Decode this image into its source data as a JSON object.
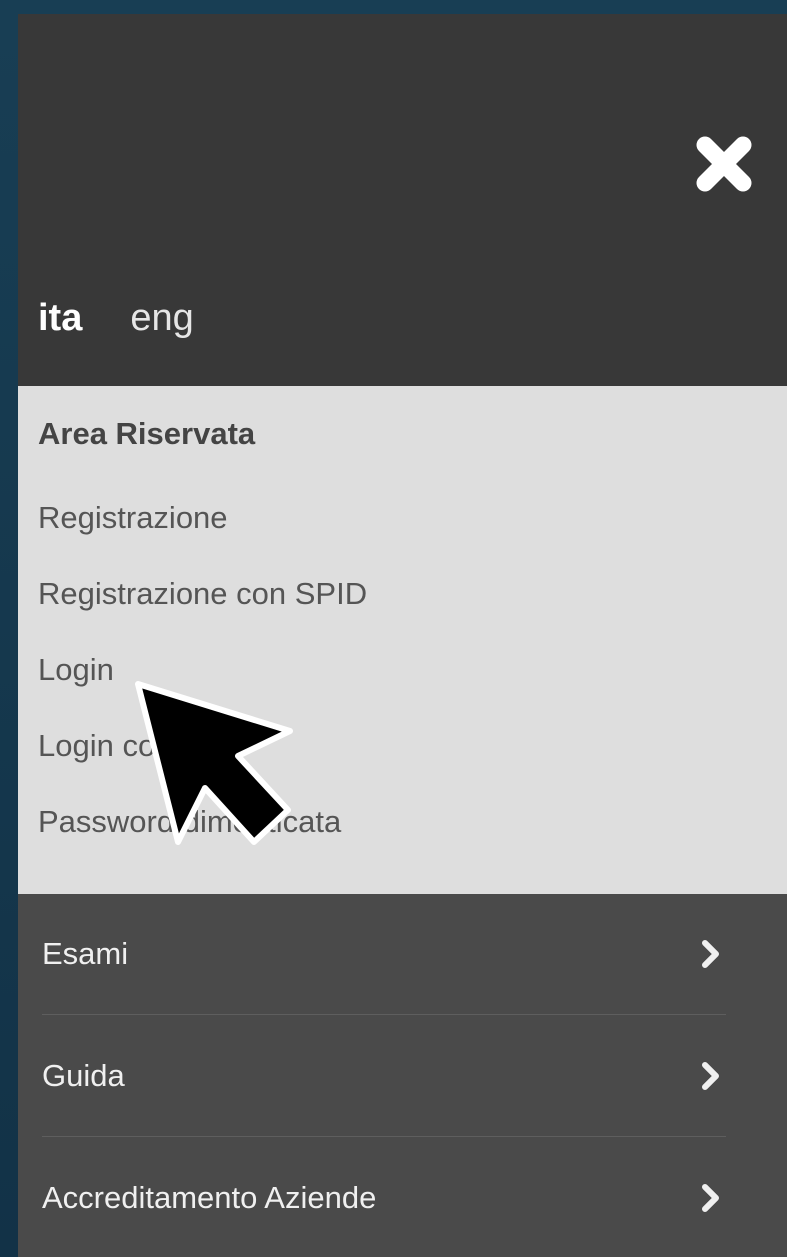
{
  "header": {
    "close_icon": "close-icon",
    "languages": {
      "ita": "ita",
      "eng": "eng",
      "active": "ita"
    }
  },
  "reserved_area": {
    "title": "Area Riservata",
    "links": [
      "Registrazione",
      "Registrazione con SPID",
      "Login",
      "Login con SPID",
      "Password dimenticata"
    ]
  },
  "nav": {
    "items": [
      {
        "label": "Esami",
        "icon": "chevron-right-icon"
      },
      {
        "label": "Guida",
        "icon": "chevron-right-icon"
      },
      {
        "label": "Accreditamento Aziende",
        "icon": "chevron-right-icon"
      }
    ]
  },
  "colors": {
    "background": "#163a4f",
    "header_bg": "#383838",
    "reserved_bg": "#dedede",
    "nav_bg": "#4a4a4a",
    "text_light": "#f0f0f0",
    "text_dark": "#555555"
  }
}
